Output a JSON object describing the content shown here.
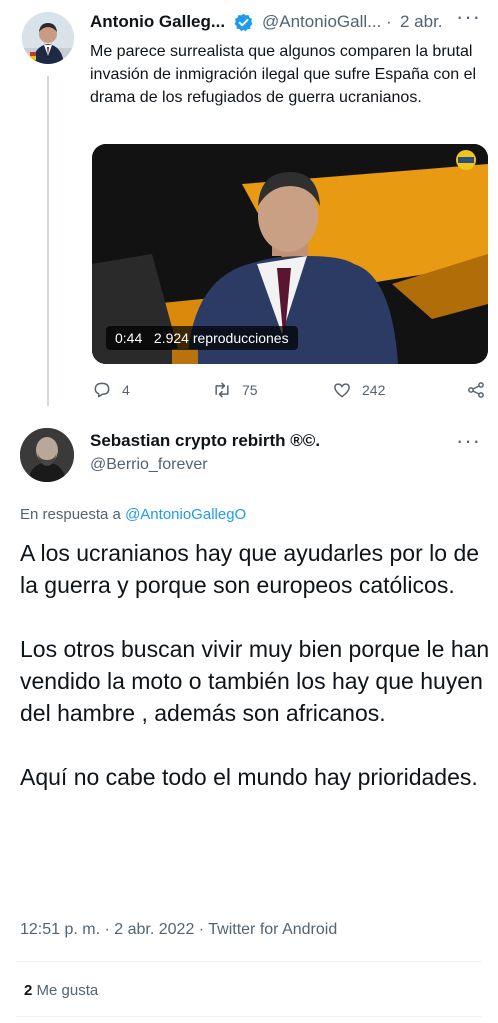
{
  "parent_tweet": {
    "author_name": "Antonio Galleg...",
    "author_handle": "@AntonioGall...",
    "separator": "·",
    "date": "2 abr.",
    "text": "Me parece surrealista que algunos comparen la brutal invasión de inmigración ilegal que sufre España con el drama de los refugiados de guerra ucranianos.",
    "video_duration": "0:44",
    "video_views": "2.924 reproducciones",
    "reply_count": "4",
    "retweet_count": "75",
    "like_count": "242",
    "icons": [
      "more-icon",
      "verified-icon",
      "reply-icon",
      "retweet-icon",
      "like-icon",
      "share-icon"
    ]
  },
  "reply_tweet": {
    "author_name": "Sebastian crypto rebirth ®©.",
    "author_handle": "@Berrio_forever",
    "in_reply_prefix": "En respuesta a",
    "in_reply_mention": "@AntonioGallegO",
    "paragraphs": [
      "A los ucranianos hay que ayudarles por lo de la guerra y porque son europeos católicos.",
      "Los otros buscan vivir muy bien porque le han vendido la moto o también los hay que huyen del hambre , además son africanos.",
      "Aquí no cabe todo el mundo hay prioridades."
    ],
    "meta": "12:51 p. m. · 2 abr. 2022 · Twitter for Android",
    "likes_count": "2",
    "likes_label": "Me gusta"
  },
  "colors": {
    "text": "#0f1419",
    "secondary": "#536471",
    "link": "#1d9bf0",
    "verified": "#1d9bf0",
    "divider": "#eff3f4"
  }
}
